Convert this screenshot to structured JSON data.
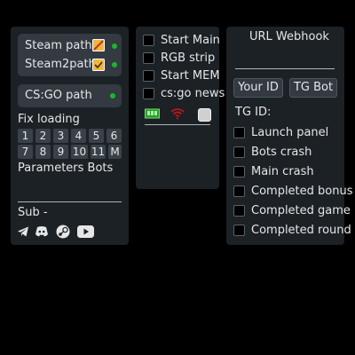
{
  "left_panel": {
    "paths": {
      "steam": "Steam  path",
      "steam2": "Steam2path"
    },
    "csgo_path": "CS:GO path",
    "fix_loading": "Fix loading",
    "buttons_row1": [
      "1",
      "2",
      "3",
      "4",
      "5",
      "6"
    ],
    "buttons_row2": [
      "7",
      "8",
      "9",
      "10",
      "11",
      "M"
    ],
    "parameters_bots": "Parameters Bots",
    "sub": "Sub -",
    "social_icons": [
      "telegram-icon",
      "discord-icon",
      "steam-icon",
      "youtube-icon"
    ]
  },
  "middle_panel": {
    "checkboxes": [
      "Start Main",
      "RGB strip",
      "Start MEM",
      "cs:go news"
    ],
    "status_icons": [
      "memory-icon",
      "wifi-icon",
      "stop-square-icon"
    ]
  },
  "right_panel": {
    "url_webhook": "URL Webhook",
    "your_id_button": "Your ID",
    "tg_bot_button": "TG Bot",
    "tg_id_label": "TG ID:",
    "checkboxes": [
      "Launch panel",
      "Bots crash",
      "Main crash",
      "Completed bonus",
      "Completed game",
      "Completed round"
    ]
  },
  "colors": {
    "background": "#000000",
    "panel": "#1c2126",
    "control": "#333a41",
    "status_green": "#1fb52d",
    "separator": "#aeb4ba"
  }
}
